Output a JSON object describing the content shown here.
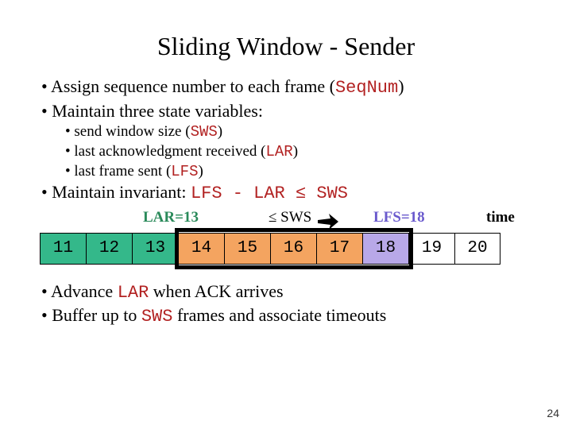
{
  "title": "Sliding Window - Sender",
  "bullets": {
    "b1a": "Assign sequence number to each frame (",
    "b1code": "SeqNum",
    "b1b": ")",
    "b2": "Maintain three state variables:",
    "sub1a": "send window size (",
    "sub1code": "SWS",
    "sub1b": ")",
    "sub2a": "last acknowledgment received (",
    "sub2code": "LAR",
    "sub2b": ")",
    "sub3a": "last frame sent (",
    "sub3code": "LFS",
    "sub3b": ")",
    "b3a": "Maintain invariant: ",
    "b3code": "LFS - LAR ≤ SWS",
    "b4a": "Advance ",
    "b4code": "LAR",
    "b4b": " when ACK arrives",
    "b5a": "Buffer up to ",
    "b5code": "SWS",
    "b5b": " frames and associate timeouts"
  },
  "diagram": {
    "lar_label": "LAR=13",
    "sws_label": "≤ SWS",
    "lfs_label": "LFS=18",
    "time_label": "time",
    "cells": {
      "c0": "11",
      "c1": "12",
      "c2": "13",
      "c3": "14",
      "c4": "15",
      "c5": "16",
      "c6": "17",
      "c7": "18",
      "c8": "19",
      "c9": "20"
    }
  },
  "page_number": "24",
  "chart_data": {
    "type": "table",
    "title": "Sliding Window - Sender",
    "sequence_numbers": [
      11,
      12,
      13,
      14,
      15,
      16,
      17,
      18,
      19,
      20
    ],
    "acknowledged": [
      11,
      12,
      13
    ],
    "in_window": [
      14,
      15,
      16,
      17,
      18
    ],
    "LAR": 13,
    "LFS": 18,
    "SWS": 5,
    "invariant": "LFS - LAR ≤ SWS"
  }
}
